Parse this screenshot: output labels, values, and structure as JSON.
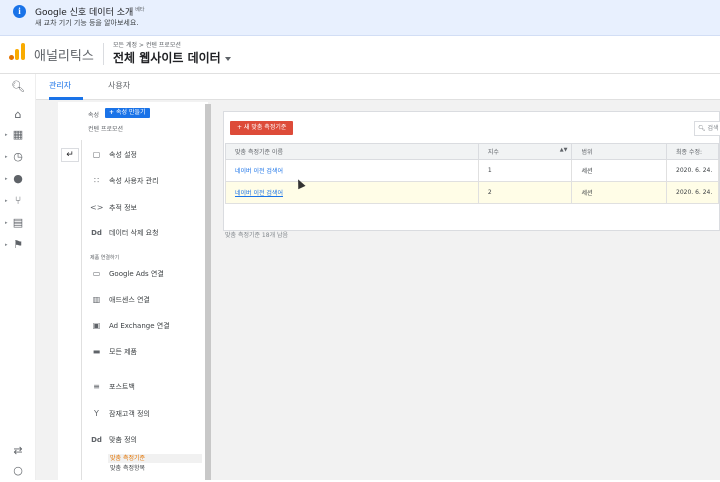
{
  "banner": {
    "title": "Google 신호 데이터 소개",
    "badge": "베타",
    "subtitle": "새 교차 기기 기능 등을 알아보세요."
  },
  "header": {
    "app_name": "애널리틱스",
    "breadcrumb": "모든 계정 > 컨텐 프로모션",
    "view_title": "전체 웹사이트 데이터"
  },
  "tabs": [
    {
      "label": "관리자",
      "active": true
    },
    {
      "label": "사용자",
      "active": false
    }
  ],
  "rail": {
    "icons": [
      "search-icon",
      "home-icon",
      "customization-icon",
      "realtime-icon",
      "audience-icon",
      "acquisition-icon",
      "behavior-icon",
      "conversions-icon",
      "attribution-icon",
      "discover-icon"
    ]
  },
  "admin": {
    "top_label": "속성",
    "create_button": "속성 만들기",
    "property_name": "컨텐 프로모션",
    "menu": [
      {
        "icon": "property-settings-icon",
        "label": "속성 설정"
      },
      {
        "icon": "user-management-icon",
        "label": "속성 사용자 관리"
      },
      {
        "icon": "tracking-code-icon",
        "label": "추적 정보"
      },
      {
        "icon": "data-deletion-icon",
        "label": "데이터 삭제 요청"
      }
    ],
    "section_label": "제품 연결하기",
    "links": [
      {
        "icon": "google-ads-icon",
        "label": "Google Ads 연결"
      },
      {
        "icon": "adsense-icon",
        "label": "애드센스 연결"
      },
      {
        "icon": "ad-exchange-icon",
        "label": "Ad Exchange 연결"
      },
      {
        "icon": "all-products-icon",
        "label": "모든 제품"
      }
    ],
    "extra": [
      {
        "icon": "postback-icon",
        "label": "포스트백"
      },
      {
        "icon": "audience-definitions-icon",
        "label": "잠재고객 정의"
      },
      {
        "icon": "custom-definitions-icon",
        "label": "맞춤 정의"
      }
    ],
    "sub_items": [
      {
        "label": "맞춤 측정기준",
        "active": true
      },
      {
        "label": "맞춤 측정항목",
        "active": false
      }
    ]
  },
  "main": {
    "new_button": "+ 새 맞춤 측정기준",
    "search_placeholder": "검색",
    "columns": [
      "맞춤 측정기준 이름",
      "지수",
      "범위",
      "최종 수정:"
    ],
    "rows": [
      {
        "name": "네이버 이전 검색어",
        "index": "1",
        "scope": "세션",
        "modified": "2020. 6. 24."
      },
      {
        "name": "네이버 이전 검색어",
        "index": "2",
        "scope": "세션",
        "modified": "2020. 6. 24."
      }
    ],
    "footnote": "맞춤 측정기준 18개 남음"
  }
}
